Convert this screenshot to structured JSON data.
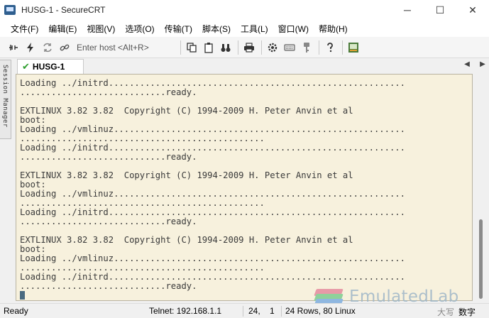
{
  "window": {
    "title": "HUSG-1 - SecureCRT",
    "controls": {
      "minimize": "─",
      "maximize": "☐",
      "close": "✕"
    }
  },
  "menu": [
    "文件(F)",
    "编辑(E)",
    "视图(V)",
    "选项(O)",
    "传输(T)",
    "脚本(S)",
    "工具(L)",
    "窗口(W)",
    "帮助(H)"
  ],
  "toolbar": {
    "host_placeholder": "Enter host <Alt+R>"
  },
  "session_manager": {
    "label": "Session Manager"
  },
  "tabs": [
    {
      "label": "HUSG-1",
      "active": true,
      "status_color": "#2e9e2e"
    }
  ],
  "terminal": {
    "background": "#f7f1dd",
    "lines": [
      "Loading ../initrd.........................................................",
      "............................ready.",
      "",
      "EXTLINUX 3.82 3.82  Copyright (C) 1994-2009 H. Peter Anvin et al",
      "boot:",
      "Loading ../vmlinuz........................................................",
      "...............................................",
      "Loading ../initrd.........................................................",
      "............................ready.",
      "",
      "EXTLINUX 3.82 3.82  Copyright (C) 1994-2009 H. Peter Anvin et al",
      "boot:",
      "Loading ../vmlinuz........................................................",
      "...............................................",
      "Loading ../initrd.........................................................",
      "............................ready.",
      "",
      "EXTLINUX 3.82 3.82  Copyright (C) 1994-2009 H. Peter Anvin et al",
      "boot:",
      "Loading ../vmlinuz........................................................",
      "...............................................",
      "Loading ../initrd.........................................................",
      "............................ready."
    ]
  },
  "watermark": {
    "text": "EmulatedLab"
  },
  "status": {
    "state": "Ready",
    "connection": "Telnet: 192.168.1.1",
    "row": "24,",
    "col": "1",
    "size": "24 Rows, 80 Linux",
    "caps": "大写",
    "num": "数字"
  }
}
